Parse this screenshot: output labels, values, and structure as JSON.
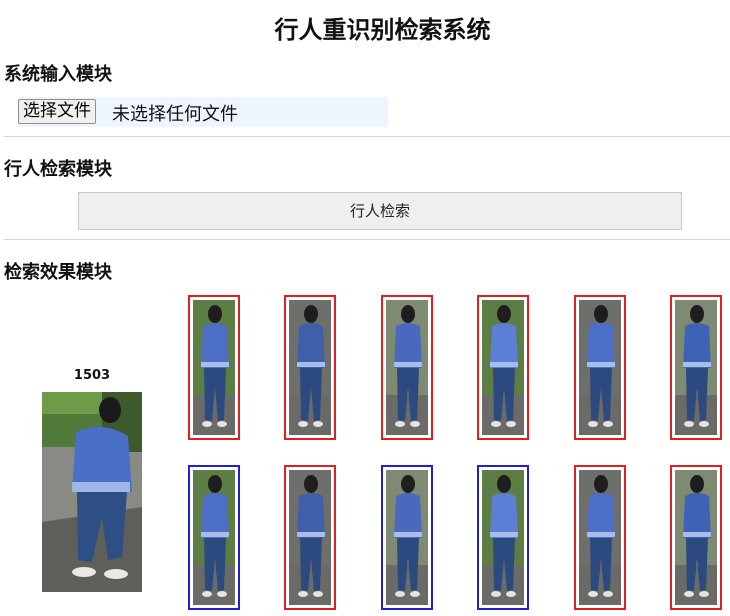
{
  "page": {
    "title": "行人重识别检索系统"
  },
  "input_section": {
    "heading": "系统输入模块",
    "file_button_label": "选择文件",
    "file_status": "未选择任何文件"
  },
  "search_section": {
    "heading": "行人检索模块",
    "search_button_label": "行人检索"
  },
  "results_section": {
    "heading": "检索效果模块",
    "query_id": "1503"
  },
  "colors": {
    "match": "#e02020",
    "mismatch": "#2020d0"
  },
  "results": [
    {
      "status": "match"
    },
    {
      "status": "match"
    },
    {
      "status": "match"
    },
    {
      "status": "match"
    },
    {
      "status": "match"
    },
    {
      "status": "match"
    },
    {
      "status": "mismatch"
    },
    {
      "status": "match"
    },
    {
      "status": "mismatch"
    },
    {
      "status": "mismatch"
    },
    {
      "status": "match"
    },
    {
      "status": "match"
    }
  ]
}
